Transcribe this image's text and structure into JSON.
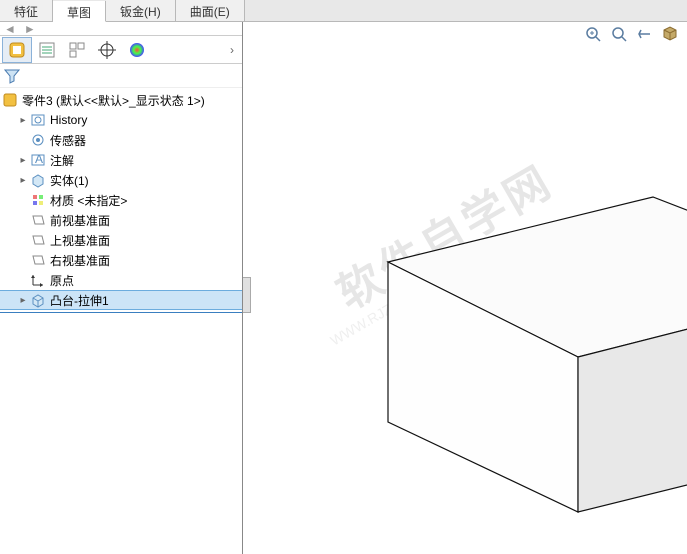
{
  "tabs": {
    "feature": "特征",
    "sketch": "草图",
    "sheetmetal": "钣金(H)",
    "surface": "曲面(E)"
  },
  "tree": {
    "root": "零件3 (默认<<默认>_显示状态 1>)",
    "history": "History",
    "sensors": "传感器",
    "annotations": "注解",
    "solidbody": "实体(1)",
    "material": "材质 <未指定>",
    "frontplane": "前视基准面",
    "topplane": "上视基准面",
    "rightplane": "右视基准面",
    "origin": "原点",
    "extrude1": "凸台-拉伸1"
  },
  "watermark": {
    "main": "软件自学网",
    "url": "WWW.RJZXW.COM"
  }
}
